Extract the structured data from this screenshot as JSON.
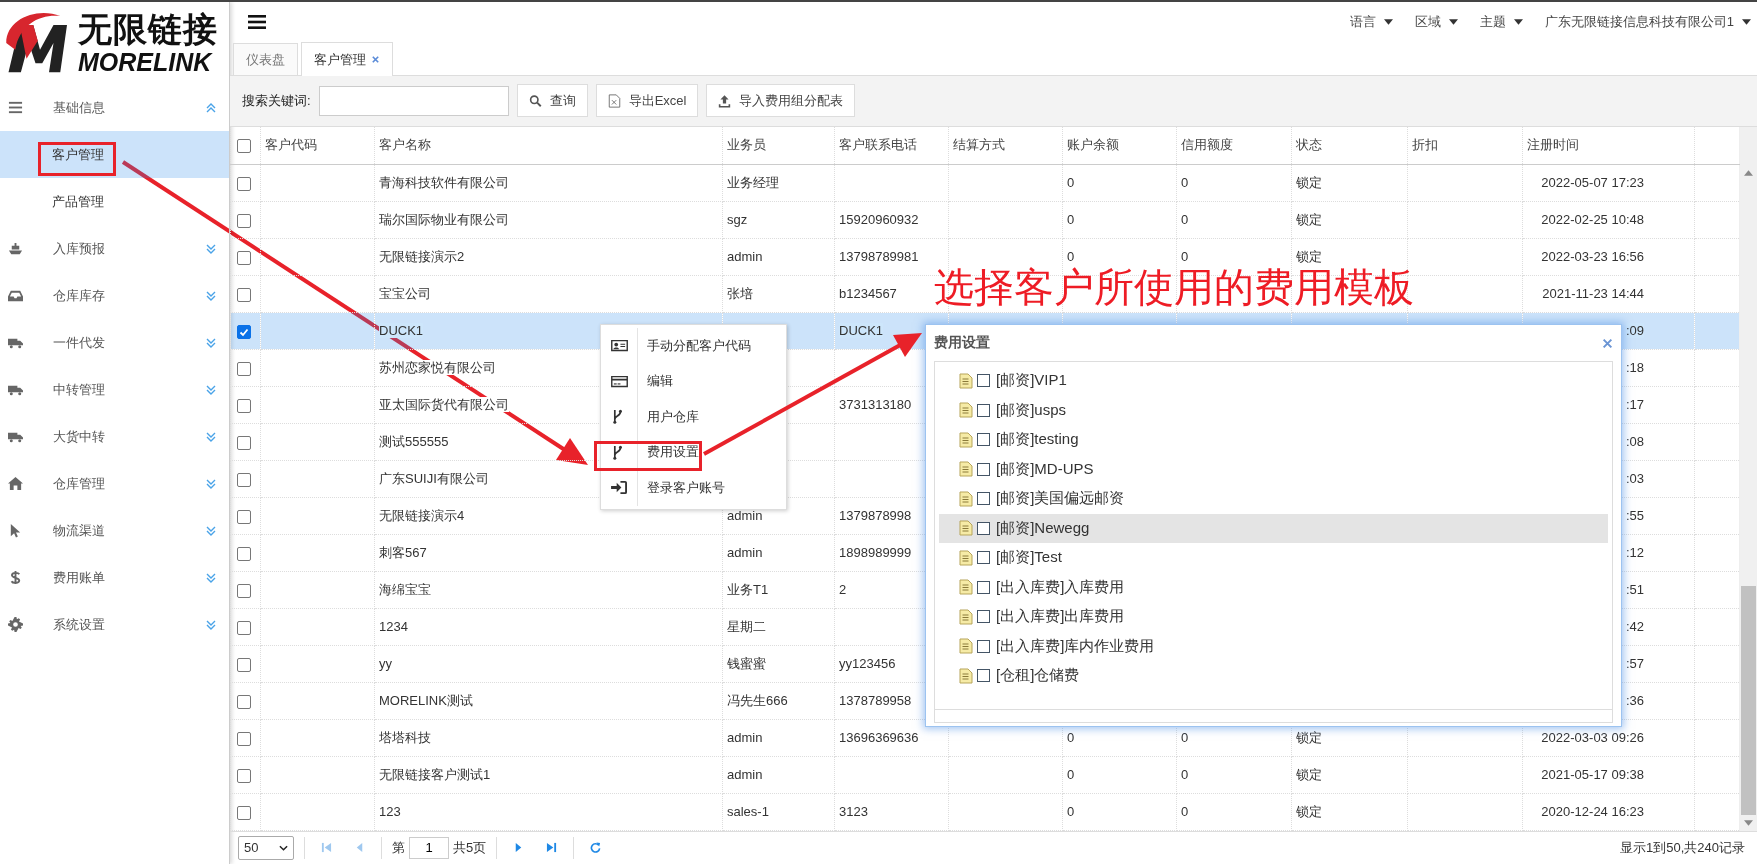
{
  "logo": {
    "name": "无限链接",
    "latin": "MORELINK"
  },
  "topbar": {
    "menus": [
      "语言",
      "区域",
      "主题",
      "广东无限链接信息科技有限公司1"
    ]
  },
  "tabs": [
    {
      "label": "仪表盘",
      "selected": false,
      "closable": false
    },
    {
      "label": "客户管理",
      "selected": true,
      "closable": true
    }
  ],
  "sidebar": {
    "items": [
      {
        "label": "基础信息",
        "expanded": true,
        "children": [
          {
            "label": "客户管理",
            "selected": true
          },
          {
            "label": "产品管理",
            "selected": false
          }
        ]
      },
      {
        "label": "入库预报",
        "expanded": false
      },
      {
        "label": "仓库库存",
        "expanded": false
      },
      {
        "label": "一件代发",
        "expanded": false
      },
      {
        "label": "中转管理",
        "expanded": false
      },
      {
        "label": "大货中转",
        "expanded": false
      },
      {
        "label": "仓库管理",
        "expanded": false
      },
      {
        "label": "物流渠道",
        "expanded": false
      },
      {
        "label": "费用账单",
        "expanded": false
      },
      {
        "label": "系统设置",
        "expanded": false
      }
    ]
  },
  "toolbar": {
    "search_label": "搜索关键词:",
    "buttons": [
      "查询",
      "导出Excel",
      "导入费用组分配表"
    ]
  },
  "table": {
    "all_checked": false,
    "columns": [
      "客户代码",
      "客户名称",
      "业务员",
      "客户联系电话",
      "结算方式",
      "账户余额",
      "信用额度",
      "状态",
      "折扣",
      "注册时间"
    ],
    "rows": [
      {
        "selected": false,
        "cells": [
          null,
          "青海科技软件有限公司",
          "业务经理",
          null,
          null,
          "0",
          "0",
          "锁定",
          null,
          "2022-05-07 17:23"
        ]
      },
      {
        "selected": false,
        "cells": [
          null,
          "瑞尔国际物业有限公司",
          "sgz",
          "15920960932",
          null,
          "0",
          "0",
          "锁定",
          null,
          "2022-02-25 10:48"
        ]
      },
      {
        "selected": false,
        "cells": [
          null,
          "无限链接演示2",
          "admin",
          "13798789981",
          null,
          "0",
          "0",
          "锁定",
          null,
          "2022-03-23 16:56"
        ]
      },
      {
        "selected": false,
        "cells": [
          null,
          "宝宝公司",
          "张培",
          "b1234567",
          null,
          null,
          null,
          null,
          null,
          "2021-11-23 14:44"
        ]
      },
      {
        "selected": true,
        "cells": [
          null,
          "DUCK1",
          null,
          "DUCK1",
          null,
          null,
          null,
          null,
          null,
          ":09"
        ]
      },
      {
        "selected": false,
        "cells": [
          null,
          "苏州恋家悦有限公司",
          null,
          null,
          null,
          null,
          null,
          null,
          null,
          ":18"
        ]
      },
      {
        "selected": false,
        "cells": [
          null,
          "亚太国际货代有限公司",
          null,
          "3731313180",
          null,
          null,
          null,
          null,
          null,
          ":17"
        ]
      },
      {
        "selected": false,
        "cells": [
          null,
          "测试555555",
          null,
          null,
          null,
          null,
          null,
          null,
          null,
          ":08"
        ]
      },
      {
        "selected": false,
        "cells": [
          null,
          "广东SUIJI有限公司",
          null,
          null,
          null,
          null,
          null,
          null,
          null,
          ":03"
        ]
      },
      {
        "selected": false,
        "cells": [
          null,
          "无限链接演示4",
          "admin",
          "1379878998",
          null,
          null,
          null,
          null,
          null,
          ":55"
        ]
      },
      {
        "selected": false,
        "cells": [
          null,
          "刺客567",
          "admin",
          "1898989999",
          null,
          null,
          null,
          null,
          null,
          ":12"
        ]
      },
      {
        "selected": false,
        "cells": [
          null,
          "海绵宝宝",
          "业务T1",
          "2",
          null,
          null,
          null,
          null,
          null,
          ":51"
        ]
      },
      {
        "selected": false,
        "cells": [
          null,
          "1234",
          "星期二",
          null,
          null,
          null,
          null,
          null,
          null,
          ":42"
        ]
      },
      {
        "selected": false,
        "cells": [
          null,
          "yy",
          "钱蜜蜜",
          "yy123456",
          null,
          null,
          null,
          null,
          null,
          ":57"
        ]
      },
      {
        "selected": false,
        "cells": [
          null,
          "MORELINK测试",
          "冯先生666",
          "1378789958",
          null,
          null,
          null,
          null,
          null,
          ":36"
        ]
      },
      {
        "selected": false,
        "cells": [
          null,
          "塔塔科技",
          "admin",
          "13696369636",
          null,
          "0",
          "0",
          "锁定",
          null,
          "2022-03-03 09:26"
        ]
      },
      {
        "selected": false,
        "cells": [
          null,
          "无限链接客户测试1",
          "admin",
          null,
          null,
          "0",
          "0",
          "锁定",
          null,
          "2021-05-17 09:38"
        ]
      },
      {
        "selected": false,
        "cells": [
          null,
          "123",
          "sales-1",
          "3123",
          null,
          "0",
          "0",
          "锁定",
          null,
          "2020-12-24 16:23"
        ]
      }
    ]
  },
  "pager": {
    "page_size": "50",
    "page_label": "第",
    "page": "1",
    "total_pages": "共5页",
    "summary": "显示1到50,共240记录"
  },
  "context_menu": {
    "items": [
      "手动分配客户代码",
      "编辑",
      "用户仓库",
      "费用设置",
      "登录客户账号"
    ]
  },
  "dialog": {
    "title": "费用设置",
    "items": [
      {
        "label": "[邮资]VIP1",
        "checked": false,
        "selected": false
      },
      {
        "label": "[邮资]usps",
        "checked": false,
        "selected": false
      },
      {
        "label": "[邮资]testing",
        "checked": false,
        "selected": false
      },
      {
        "label": "[邮资]MD-UPS",
        "checked": false,
        "selected": false
      },
      {
        "label": "[邮资]美国偏远邮资",
        "checked": false,
        "selected": false
      },
      {
        "label": "[邮资]Newegg",
        "checked": false,
        "selected": true
      },
      {
        "label": "[邮资]Test",
        "checked": false,
        "selected": false
      },
      {
        "label": "[出入库费]入库费用",
        "checked": false,
        "selected": false
      },
      {
        "label": "[出入库费]出库费用",
        "checked": false,
        "selected": false
      },
      {
        "label": "[出入库费]库内作业费用",
        "checked": false,
        "selected": false
      },
      {
        "label": "[仓租]仓储费",
        "checked": false,
        "selected": false
      }
    ]
  },
  "annotation": {
    "text": "选择客户所使用的费用模板"
  }
}
